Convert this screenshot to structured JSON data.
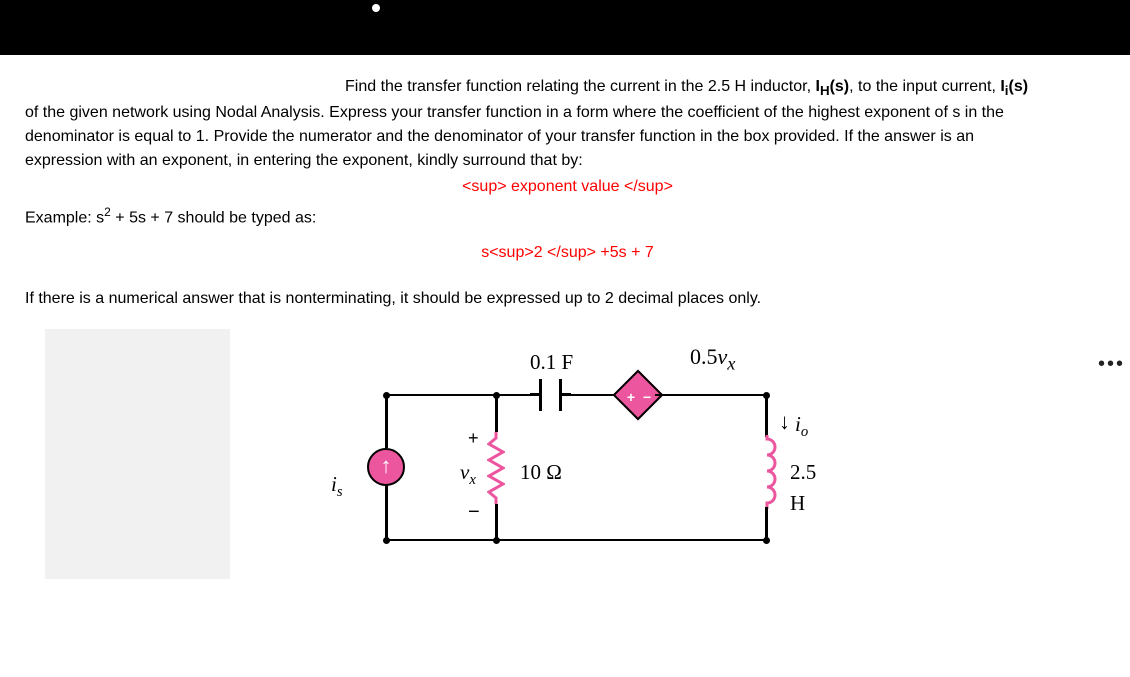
{
  "problem": {
    "line1_prefix": "Find the transfer function relating the current in the 2.5 H inductor, ",
    "line1_sym1_base": "I",
    "line1_sym1_sub": "H",
    "line1_sym1_arg": "(s)",
    "line1_mid": ", to the input current, ",
    "line1_sym2_base": "I",
    "line1_sym2_sub": "i",
    "line1_sym2_arg": "(s)",
    "line2": "of the given network using Nodal Analysis. Express your transfer function in a form where the coefficient of the highest exponent of s in the",
    "line3": "denominator is equal to 1. Provide the numerator and the denominator of your transfer function in the box provided. If the answer is an",
    "line4": "expression with an exponent, in entering the exponent, kindly surround that by:",
    "sup_hint": "<sup> exponent value </sup>",
    "example_label": "Example: s",
    "example_exp": "2",
    "example_rest": " + 5s + 7 should be typed as:",
    "example_typed": "s<sup>2 </sup> +5s + 7",
    "nonterminating": "If there is a numerical answer that is nonterminating, it should be expressed up to 2 decimal places only."
  },
  "circuit": {
    "cap_label": "0.1 F",
    "dep_label_val": "0.5",
    "dep_label_var_base": "v",
    "dep_label_var_sub": "x",
    "dep_polarity": "+  −",
    "is_label_base": "i",
    "is_label_sub": "s",
    "vx_base": "v",
    "vx_sub": "x",
    "vx_plus": "+",
    "vx_minus": "−",
    "res_label": "10 Ω",
    "ind_label": "2.5 H",
    "io_base": "i",
    "io_sub": "o",
    "io_arrow": "↓",
    "ellipsis": "•••"
  }
}
